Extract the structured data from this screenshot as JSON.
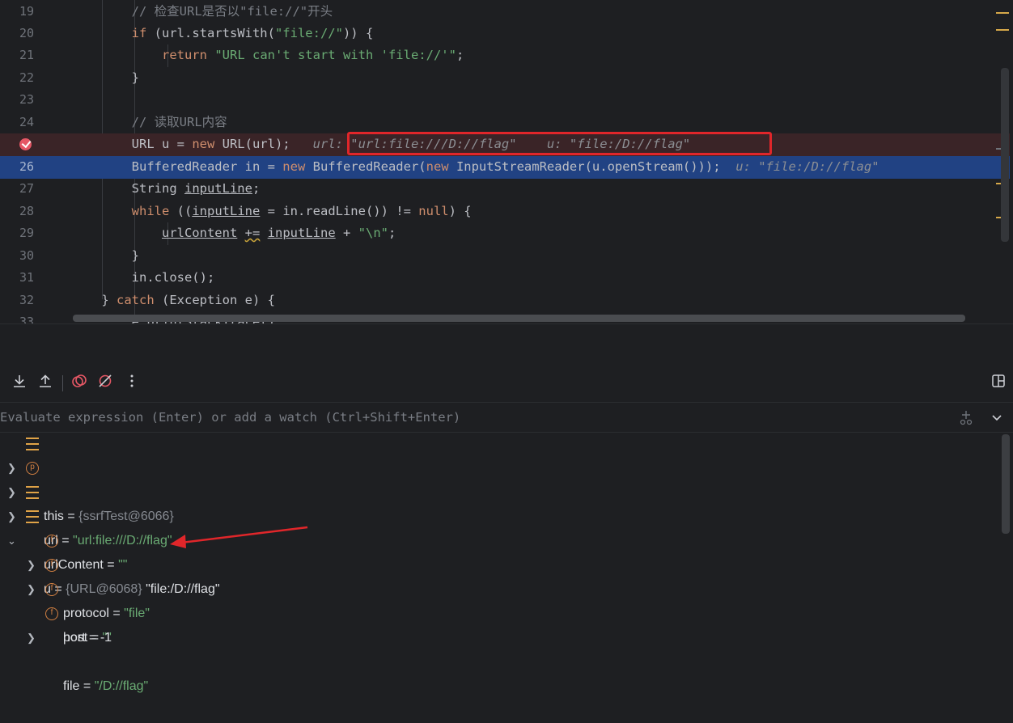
{
  "editor": {
    "lines": {
      "l19": {
        "num": "19",
        "comment": "// 检查URL是否以\"file://\"开头"
      },
      "l20": {
        "num": "20",
        "kw_if": "if",
        "t1": " (url.startsWith(",
        "str": "\"file://\"",
        "t2": ")) {"
      },
      "l21": {
        "num": "21",
        "kw_return": "return",
        "str": "\"URL can't start with 'file://'\"",
        "t2": ";"
      },
      "l22": {
        "num": "22",
        "text": "}"
      },
      "l23": {
        "num": "23"
      },
      "l24": {
        "num": "24",
        "comment": "// 读取URL内容"
      },
      "l25": {
        "num": "25",
        "t1": "URL u = ",
        "kw_new": "new",
        "t2": " URL(url);",
        "hint": "url: \"url:file:///D://flag\"    u: \"file:/D://flag\""
      },
      "l26": {
        "num": "26",
        "t1": "BufferedReader in = ",
        "kw_new1": "new",
        "t2": " BufferedReader(",
        "kw_new2": "new",
        "t3": " InputStreamReader(u.openStream()));",
        "hint": "u: \"file:/D://flag\""
      },
      "l27": {
        "num": "27",
        "t1": "String ",
        "var": "inputLine",
        "t2": ";"
      },
      "l28": {
        "num": "28",
        "kw_while": "while",
        "t1": " ((",
        "var": "inputLine",
        "t2": " = in.readLine()) != ",
        "kw_null": "null",
        "t3": ") {"
      },
      "l29": {
        "num": "29",
        "var1": "urlContent",
        "op": "+=",
        "var2": "inputLine",
        "t1": " + ",
        "str": "\"\\n\"",
        "t2": ";"
      },
      "l30": {
        "num": "30",
        "text": "}"
      },
      "l31": {
        "num": "31",
        "text": "in.close();"
      },
      "l32": {
        "num": "32",
        "t1": "} ",
        "kw_catch": "catch",
        "t2": " (Exception e) {"
      },
      "l33": {
        "num": "33",
        "text": "e.printStackTrace();"
      }
    }
  },
  "debugger": {
    "toolbar_icons": [
      "download-icon",
      "upload-icon",
      "view-breakpoints-icon",
      "mute-breakpoints-icon",
      "more-icon",
      "layout-icon"
    ],
    "evaluate_placeholder": "Evaluate expression (Enter) or add a watch (Ctrl+Shift+Enter)",
    "variables": [
      {
        "name": "this",
        "eq": " = ",
        "type": "{ssrfTest@6066}"
      },
      {
        "name": "url",
        "eq": " = ",
        "value": "\"url:file:///D://flag\""
      },
      {
        "name": "urlContent",
        "eq": " = ",
        "value": "\"\""
      },
      {
        "name": "u",
        "eq": " = ",
        "type": "{URL@6068} ",
        "value": "\"file:/D://flag\""
      },
      {
        "name": "protocol",
        "eq": " = ",
        "value": "\"file\""
      },
      {
        "name": "host",
        "eq": " = ",
        "value": "\"\""
      },
      {
        "name": "port",
        "eq": " = ",
        "value": "-1"
      },
      {
        "name": "file",
        "eq": " = ",
        "value": "\"/D://flag\""
      }
    ],
    "icon_letters": {
      "param": "p",
      "field": "f"
    }
  },
  "colors": {
    "highlight_box": "#e0262a",
    "annotation_arrow": "#e0262a",
    "current_line": "#214283",
    "breakpoint_line": "#3a2427",
    "keyword": "#cf8e6d",
    "string": "#6aab73"
  }
}
